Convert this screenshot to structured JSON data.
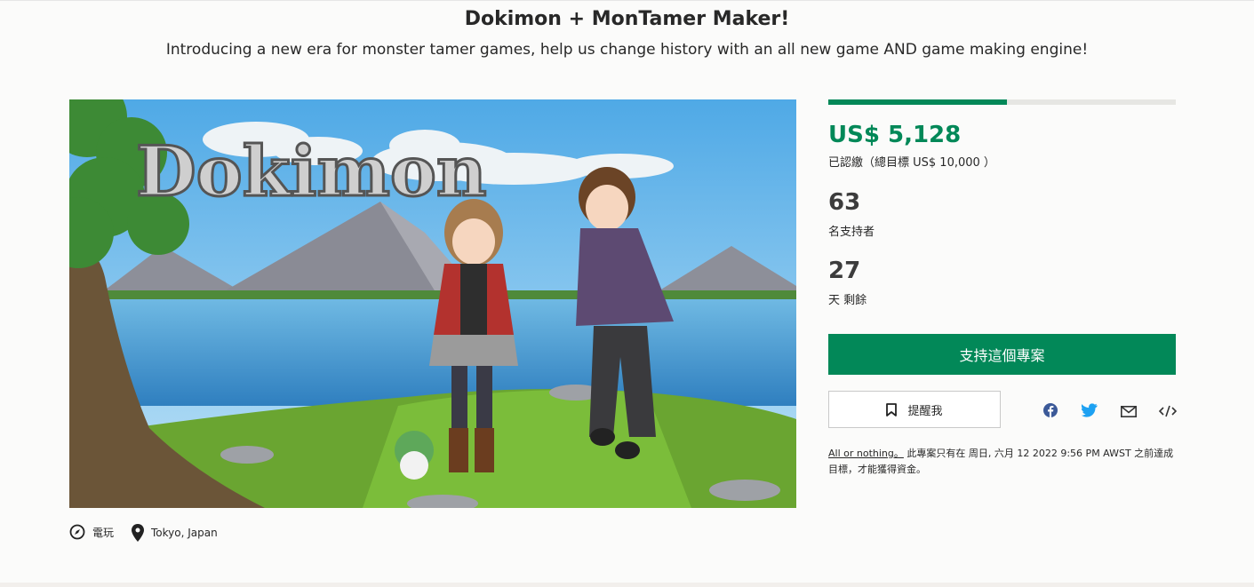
{
  "project": {
    "title": "Dokimon + MonTamer Maker!",
    "subtitle": "Introducing a new era for monster tamer games, help us change history with an all new game AND game making engine!"
  },
  "hero": {
    "logo_text": "Dokimon",
    "icon": "project-hero-image"
  },
  "meta": {
    "category": {
      "icon": "compass-icon",
      "label": "電玩"
    },
    "location": {
      "icon": "map-pin-icon",
      "label": "Tokyo, Japan"
    }
  },
  "stats": {
    "progress_fraction": 0.5128,
    "pledged": "US$ 5,128",
    "pledged_sub": "已認繳（總目標 US$ 10,000 ）",
    "backers_count": "63",
    "backers_label": "名支持者",
    "days_count": "27",
    "days_label": "天 剩餘"
  },
  "actions": {
    "back_label": "支持這個專案",
    "remind_label": "提醒我",
    "remind_icon": "bookmark-icon",
    "share_icons": [
      "facebook-icon",
      "twitter-icon",
      "email-icon",
      "embed-icon"
    ]
  },
  "funding_note": {
    "link": "All or nothing。",
    "text": " 此專案只有在 周日, 六月 12 2022 9:56 PM AWST 之前達成目標，才能獲得資金。"
  },
  "colors": {
    "accent": "#028858",
    "facebook": "#3b5998",
    "twitter": "#1da1f2"
  }
}
